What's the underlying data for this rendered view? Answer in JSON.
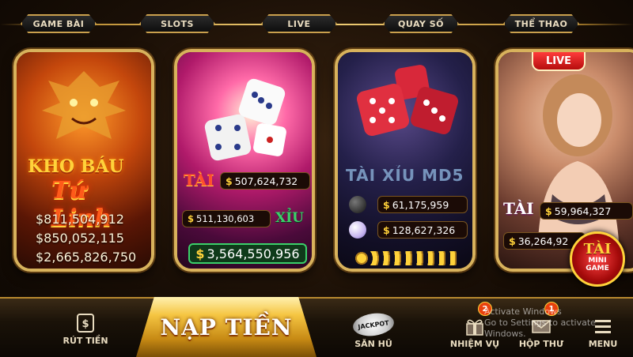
{
  "tabs": [
    "GAME BÀI",
    "SLOTS",
    "LIVE",
    "QUAY SỐ",
    "THỂ THAO"
  ],
  "cards": {
    "kho_bau": {
      "title_line1": "KHO BÁU",
      "title_line2": "Tứ Linh",
      "jackpots": [
        "$811,504,912",
        "$850,052,115",
        "$2,665,826,750"
      ]
    },
    "slots": {
      "tai_label": "TÀI",
      "xiu_label": "XỈU",
      "tai_amount": "507,624,732",
      "xiu_amount": "511,130,603",
      "total_amount": "3,564,550,956"
    },
    "md5": {
      "title": "TÀI XỈU MD5",
      "black_amount": "61,175,959",
      "white_amount": "128,627,326"
    },
    "live": {
      "badge": "LIVE",
      "tai_label": "TÀI",
      "tai_amount": "59,964,327",
      "xiu_amount": "36,264,92"
    }
  },
  "currency_symbol": "$",
  "mini_game": {
    "tai": "TÀI",
    "label_line1": "MINI",
    "label_line2": "GAME"
  },
  "bottom_nav": {
    "rut_tien": "RÚT TIỀN",
    "nap_tien": "NẠP TIỀN",
    "san_hu": "SĂN HŨ",
    "jackpot_badge": "JACKPOT",
    "nhiem_vu": "NHIỆM VỤ",
    "nhiem_vu_count": "2",
    "hop_thu": "HỘP THƯ",
    "hop_thu_count": "1",
    "menu": "MENU"
  },
  "watermark": {
    "line1": "Activate Windows",
    "line2": "Go to Settings to activate Windows."
  }
}
